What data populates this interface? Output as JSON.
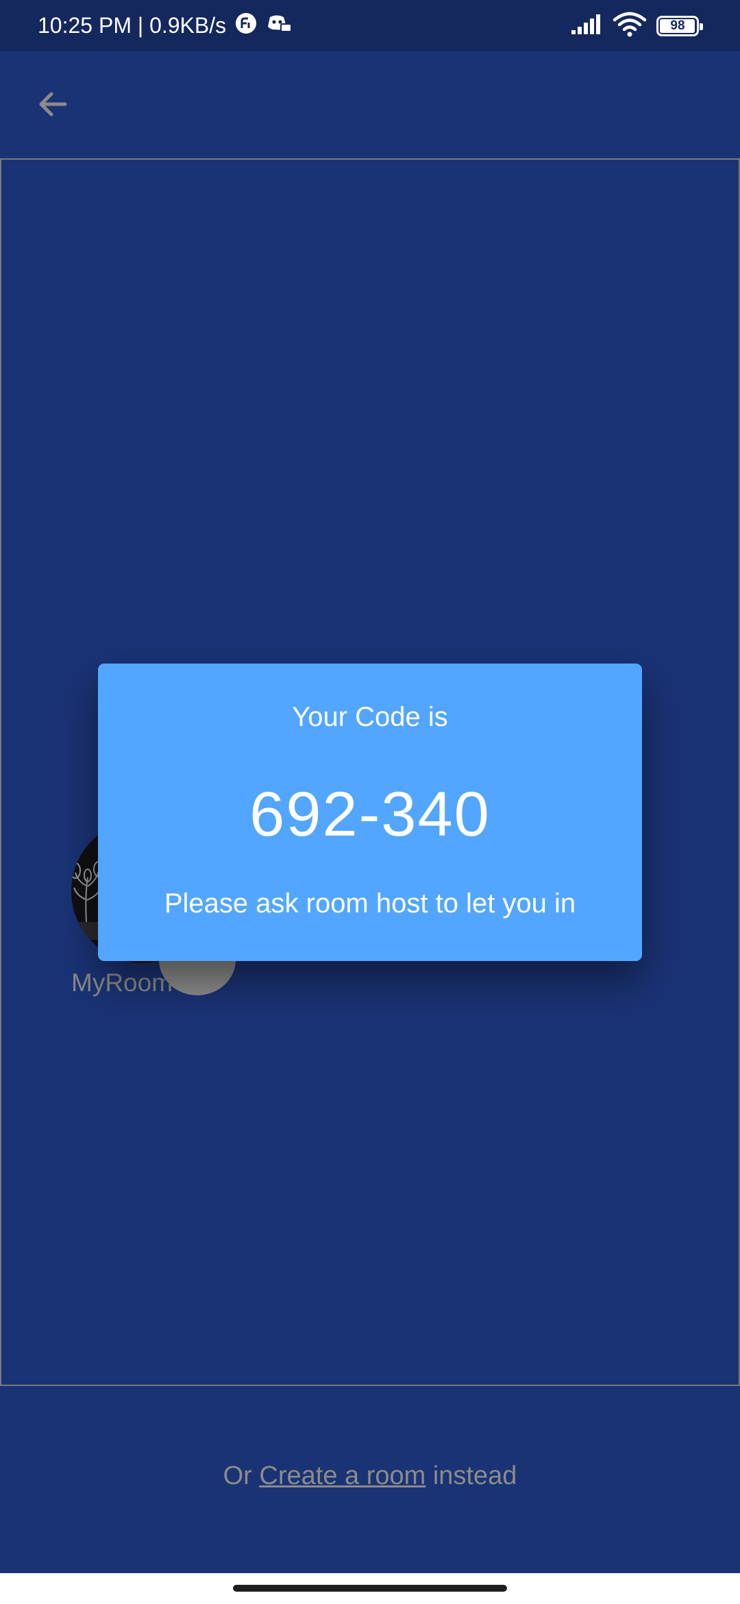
{
  "status_bar": {
    "time_speed": "10:25 PM | 0.9KB/s",
    "battery_level": "98",
    "icons": [
      "notification-app-icon",
      "discord-icon",
      "signal-icon",
      "wifi-icon",
      "battery-icon"
    ]
  },
  "app_bar": {
    "back_icon": "arrow-left-icon"
  },
  "room": {
    "name": "MyRoom"
  },
  "dialog": {
    "title": "Your Code is",
    "code": "692-340",
    "message": "Please ask room host to let you in"
  },
  "footer": {
    "prefix": "Or ",
    "link": "Create a room",
    "suffix": " instead"
  },
  "colors": {
    "background": "#1a3375",
    "status_bar": "#15285e",
    "dialog": "#52a6ff",
    "muted_text": "#8b8b8b"
  }
}
